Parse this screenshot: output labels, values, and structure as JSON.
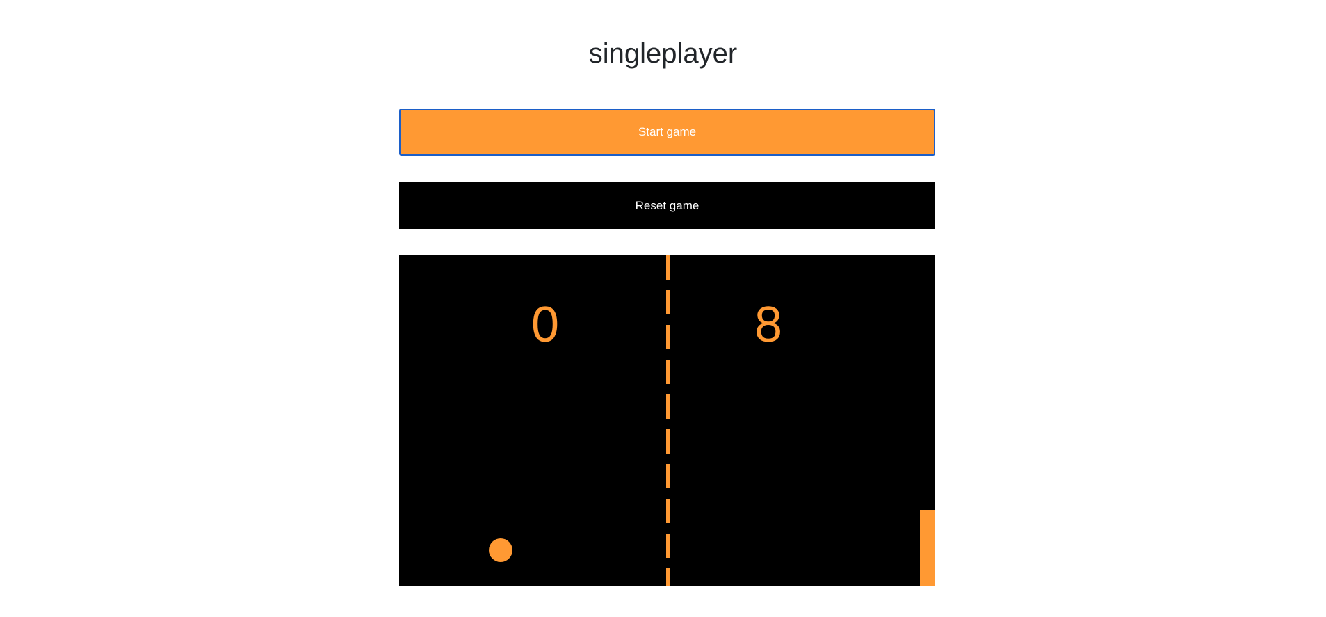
{
  "page": {
    "title": "singleplayer"
  },
  "controls": {
    "start_label": "Start game",
    "reset_label": "Reset game"
  },
  "game": {
    "score_left": "0",
    "score_right": "8",
    "colors": {
      "court": "#000000",
      "accent": "#ff9933"
    }
  }
}
